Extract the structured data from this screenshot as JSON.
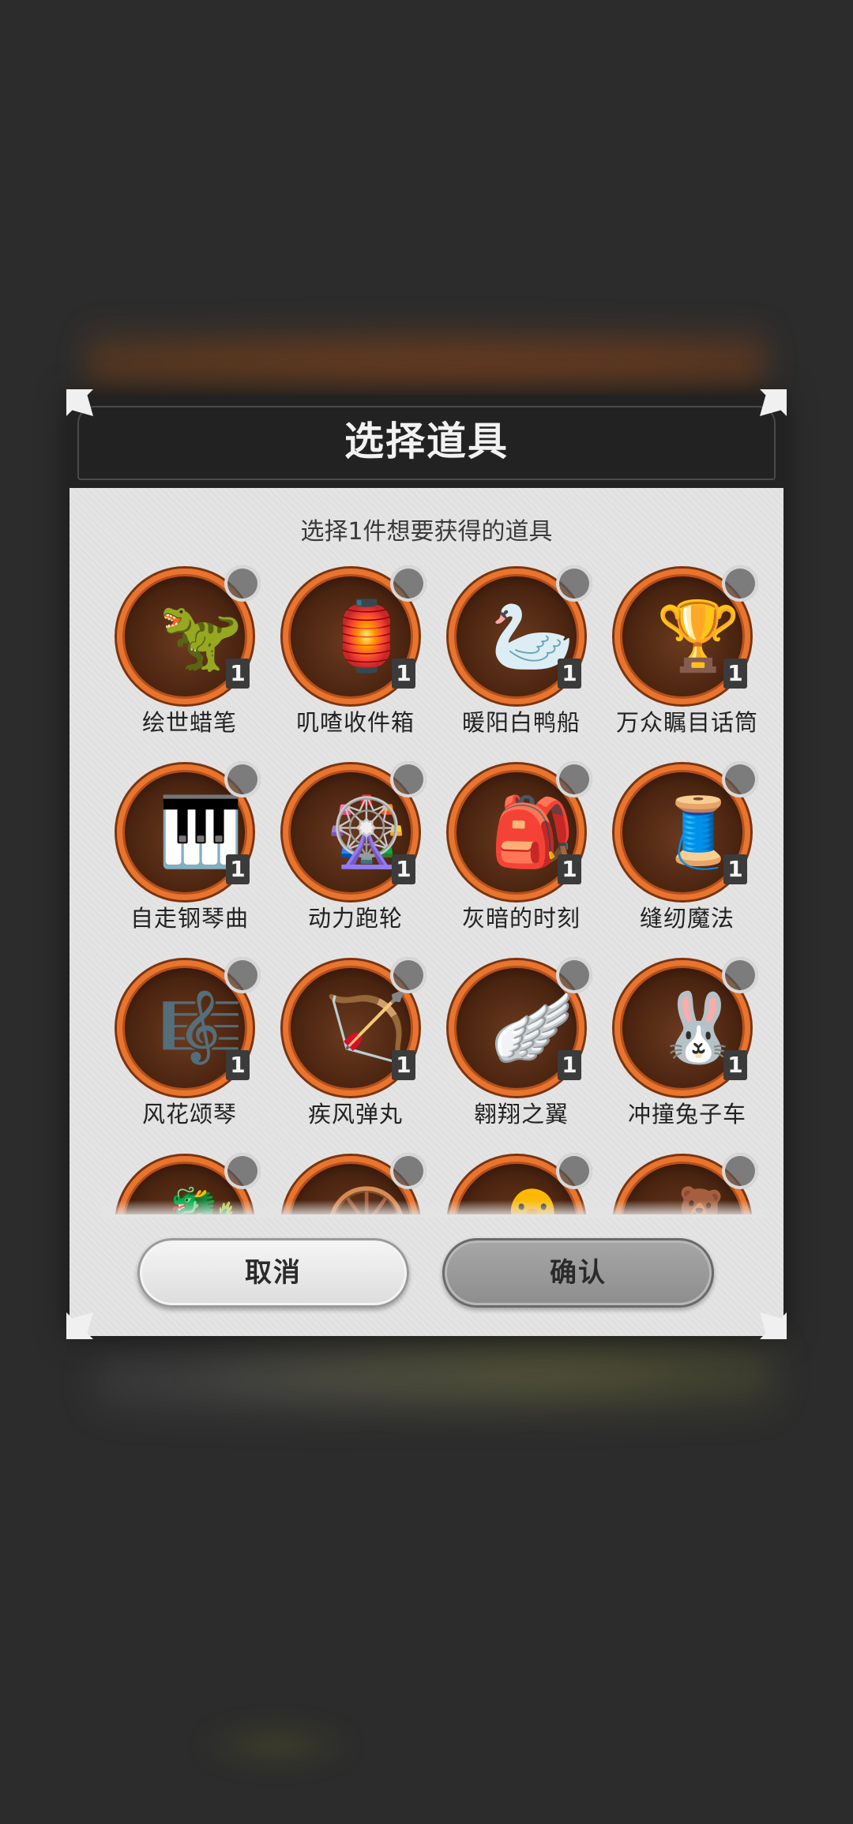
{
  "dialog": {
    "title": "选择道具",
    "subtitle": "选择1件想要获得的道具",
    "cancel_label": "取消",
    "confirm_label": "确认"
  },
  "items": [
    {
      "name": "绘世蜡笔",
      "qty": "1",
      "icon": "🦖"
    },
    {
      "name": "叽喳收件箱",
      "qty": "1",
      "icon": "🏮"
    },
    {
      "name": "暖阳白鸭船",
      "qty": "1",
      "icon": "🦢"
    },
    {
      "name": "万众瞩目话筒",
      "qty": "1",
      "icon": "🏆"
    },
    {
      "name": "自走钢琴曲",
      "qty": "1",
      "icon": "🎹"
    },
    {
      "name": "动力跑轮",
      "qty": "1",
      "icon": "🎡"
    },
    {
      "name": "灰暗的时刻",
      "qty": "1",
      "icon": "🎒"
    },
    {
      "name": "缝纫魔法",
      "qty": "1",
      "icon": "🧵"
    },
    {
      "name": "风花颂琴",
      "qty": "1",
      "icon": "🎼"
    },
    {
      "name": "疾风弹丸",
      "qty": "1",
      "icon": "🏹"
    },
    {
      "name": "翱翔之翼",
      "qty": "1",
      "icon": "🪽"
    },
    {
      "name": "冲撞兔子车",
      "qty": "1",
      "icon": "🐰"
    },
    {
      "name": "",
      "qty": "",
      "icon": "🐉"
    },
    {
      "name": "",
      "qty": "",
      "icon": "🛞"
    },
    {
      "name": "",
      "qty": "",
      "icon": "🐥"
    },
    {
      "name": "",
      "qty": "",
      "icon": "🧸"
    }
  ],
  "colors": {
    "ring_outer": "#e9742d",
    "ring_inner": "#4a2410",
    "dialog_bg": "#e4e4e4",
    "header_bg": "#222222"
  }
}
